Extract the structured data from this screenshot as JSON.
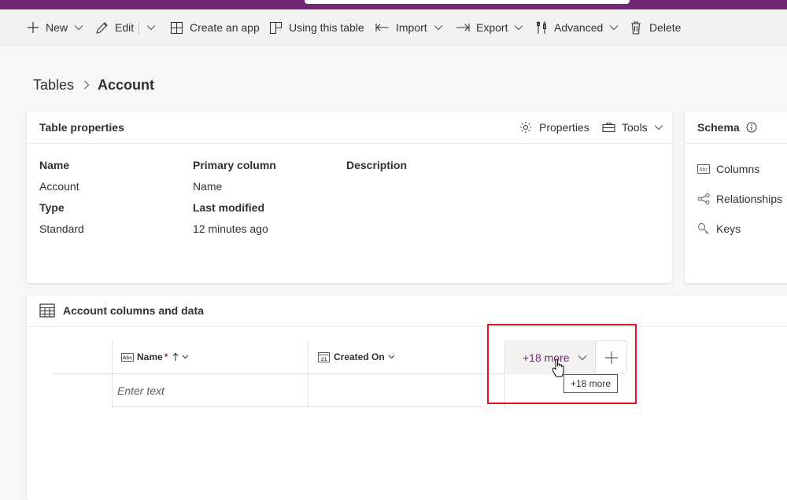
{
  "toolbar": {
    "new_label": "New",
    "edit_label": "Edit",
    "create_app_label": "Create an app",
    "using_table_label": "Using this table",
    "import_label": "Import",
    "export_label": "Export",
    "advanced_label": "Advanced",
    "delete_label": "Delete"
  },
  "breadcrumb": {
    "parent": "Tables",
    "current": "Account"
  },
  "table_properties": {
    "title": "Table properties",
    "properties_label": "Properties",
    "tools_label": "Tools",
    "fields": {
      "name_label": "Name",
      "name_value": "Account",
      "type_label": "Type",
      "type_value": "Standard",
      "primary_column_label": "Primary column",
      "primary_column_value": "Name",
      "last_modified_label": "Last modified",
      "last_modified_value": "12 minutes ago",
      "description_label": "Description"
    }
  },
  "schema": {
    "title": "Schema",
    "items": [
      {
        "label": "Columns",
        "icon": "abc-text-icon"
      },
      {
        "label": "Relationships",
        "icon": "relationships-icon"
      },
      {
        "label": "Keys",
        "icon": "key-icon"
      }
    ]
  },
  "columns_data": {
    "title": "Account columns and data",
    "columns": [
      {
        "label": "Name",
        "required_marker": "*",
        "icon": "abc-text-icon"
      },
      {
        "label": "Created On",
        "icon": "calendar-icon"
      }
    ],
    "name_input_placeholder": "Enter text",
    "more_columns_label": "+18 more",
    "tooltip": "+18 more"
  },
  "colors": {
    "accent": "#742774",
    "highlight": "#e81123"
  }
}
